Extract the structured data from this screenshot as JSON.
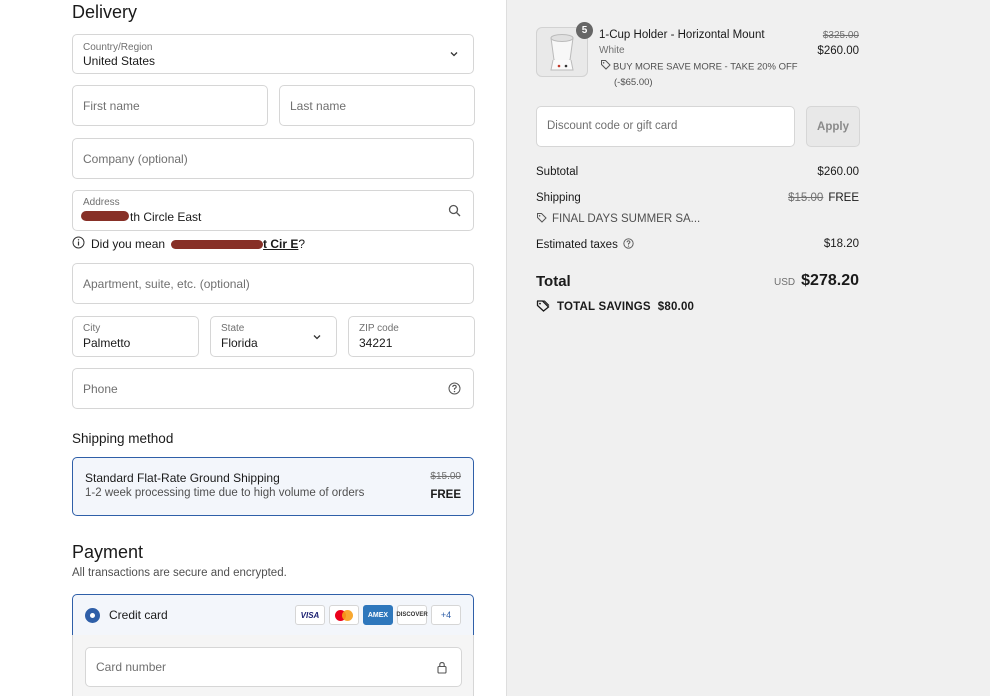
{
  "delivery": {
    "title": "Delivery",
    "country_label": "Country/Region",
    "country_value": "United States",
    "first_name_placeholder": "First name",
    "last_name_placeholder": "Last name",
    "company_placeholder": "Company (optional)",
    "address_label": "Address",
    "address_value": "th Circle East",
    "did_you_mean_prefix": "Did you mean",
    "did_you_mean_suggestion": "t Cir E",
    "did_you_mean_suffix": "?",
    "apartment_placeholder": "Apartment, suite, etc. (optional)",
    "city_label": "City",
    "city_value": "Palmetto",
    "state_label": "State",
    "state_value": "Florida",
    "zip_label": "ZIP code",
    "zip_value": "34221",
    "phone_placeholder": "Phone"
  },
  "shipping": {
    "title": "Shipping method",
    "option_name": "Standard Flat-Rate Ground Shipping",
    "option_desc": "1-2 week processing time due to high volume of orders",
    "original_price": "$15.00",
    "price": "FREE"
  },
  "payment": {
    "title": "Payment",
    "note": "All transactions are secure and encrypted.",
    "method_label": "Credit card",
    "cards": [
      "VISA",
      "AMEX",
      "DISCOVER",
      "+4"
    ],
    "card_number_placeholder": "Card number"
  },
  "order": {
    "quantity": "5",
    "product_name": "1-Cup Holder - Horizontal Mount",
    "variant": "White",
    "discount_text": "BUY MORE SAVE MORE - TAKE 20% OFF",
    "discount_amount": "(-$65.00)",
    "original_price": "$325.00",
    "price": "$260.00",
    "discount_placeholder": "Discount code or gift card",
    "apply_label": "Apply",
    "subtotal_label": "Subtotal",
    "subtotal_value": "$260.00",
    "shipping_label": "Shipping",
    "shipping_original": "$15.00",
    "shipping_value": "FREE",
    "shipping_discount": "FINAL DAYS SUMMER SA...",
    "taxes_label": "Estimated taxes",
    "taxes_value": "$18.20",
    "total_label": "Total",
    "currency": "USD",
    "total_value": "$278.20",
    "savings_label": "TOTAL SAVINGS",
    "savings_value": "$80.00"
  },
  "colors": {
    "accent": "#2f5fa8",
    "sidebar_bg": "#f0f0f0"
  }
}
